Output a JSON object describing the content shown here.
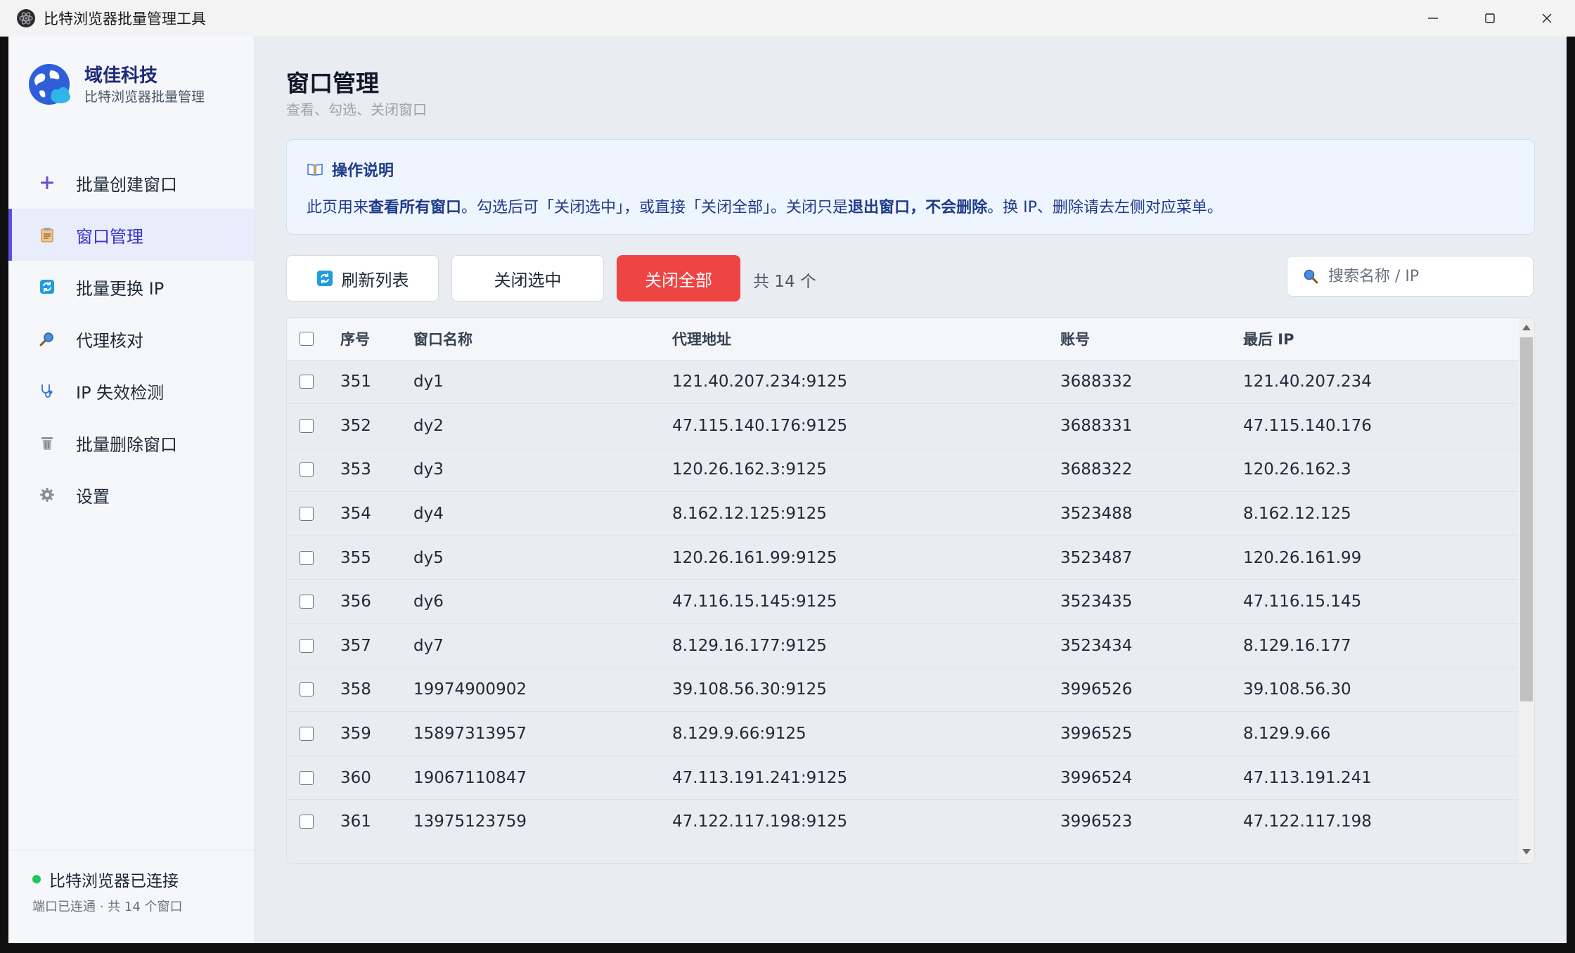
{
  "window": {
    "title": "比特浏览器批量管理工具"
  },
  "brand": {
    "name": "域佳科技",
    "subtitle": "比特浏览器批量管理"
  },
  "nav": [
    {
      "label": "批量创建窗口",
      "icon": "plus-icon",
      "active": false
    },
    {
      "label": "窗口管理",
      "icon": "clipboard-icon",
      "active": true
    },
    {
      "label": "批量更换 IP",
      "icon": "refresh-icon",
      "active": false
    },
    {
      "label": "代理核对",
      "icon": "magnifier-icon",
      "active": false
    },
    {
      "label": "IP 失效检测",
      "icon": "stethoscope-icon",
      "active": false
    },
    {
      "label": "批量删除窗口",
      "icon": "trash-icon",
      "active": false
    },
    {
      "label": "设置",
      "icon": "gear-icon",
      "active": false
    }
  ],
  "status": {
    "connected": "比特浏览器已连接",
    "detail": "端口已连通 · 共 14 个窗口",
    "color": "#22c55e"
  },
  "page": {
    "title": "窗口管理",
    "subtitle": "查看、勾选、关闭窗口"
  },
  "info": {
    "heading": "操作说明",
    "parts": [
      {
        "text": "此页用来",
        "bold": false
      },
      {
        "text": "查看所有窗口",
        "bold": true
      },
      {
        "text": "。勾选后可「关闭选中」，或直接「关闭全部」。关闭只是",
        "bold": false
      },
      {
        "text": "退出窗口",
        "bold": true
      },
      {
        "text": "，",
        "bold": false
      },
      {
        "text": "不会删除",
        "bold": true
      },
      {
        "text": "。换 IP、删除请去左侧对应菜单。",
        "bold": false
      }
    ]
  },
  "toolbar": {
    "refresh_label": "刷新列表",
    "close_selected_label": "关闭选中",
    "close_all_label": "关闭全部",
    "count_text": "共 14 个",
    "search_placeholder": "搜索名称 / IP",
    "danger_color": "#ef4444"
  },
  "table": {
    "columns": [
      "序号",
      "窗口名称",
      "代理地址",
      "账号",
      "最后 IP"
    ],
    "rows": [
      [
        "351",
        "dy1",
        "121.40.207.234:9125",
        "3688332",
        "121.40.207.234"
      ],
      [
        "352",
        "dy2",
        "47.115.140.176:9125",
        "3688331",
        "47.115.140.176"
      ],
      [
        "353",
        "dy3",
        "120.26.162.3:9125",
        "3688322",
        "120.26.162.3"
      ],
      [
        "354",
        "dy4",
        "8.162.12.125:9125",
        "3523488",
        "8.162.12.125"
      ],
      [
        "355",
        "dy5",
        "120.26.161.99:9125",
        "3523487",
        "120.26.161.99"
      ],
      [
        "356",
        "dy6",
        "47.116.15.145:9125",
        "3523435",
        "47.116.15.145"
      ],
      [
        "357",
        "dy7",
        "8.129.16.177:9125",
        "3523434",
        "8.129.16.177"
      ],
      [
        "358",
        "19974900902",
        "39.108.56.30:9125",
        "3996526",
        "39.108.56.30"
      ],
      [
        "359",
        "15897313957",
        "8.129.9.66:9125",
        "3996525",
        "8.129.9.66"
      ],
      [
        "360",
        "19067110847",
        "47.113.191.241:9125",
        "3996524",
        "47.113.191.241"
      ],
      [
        "361",
        "13975123759",
        "47.122.117.198:9125",
        "3996523",
        "47.122.117.198"
      ]
    ]
  }
}
